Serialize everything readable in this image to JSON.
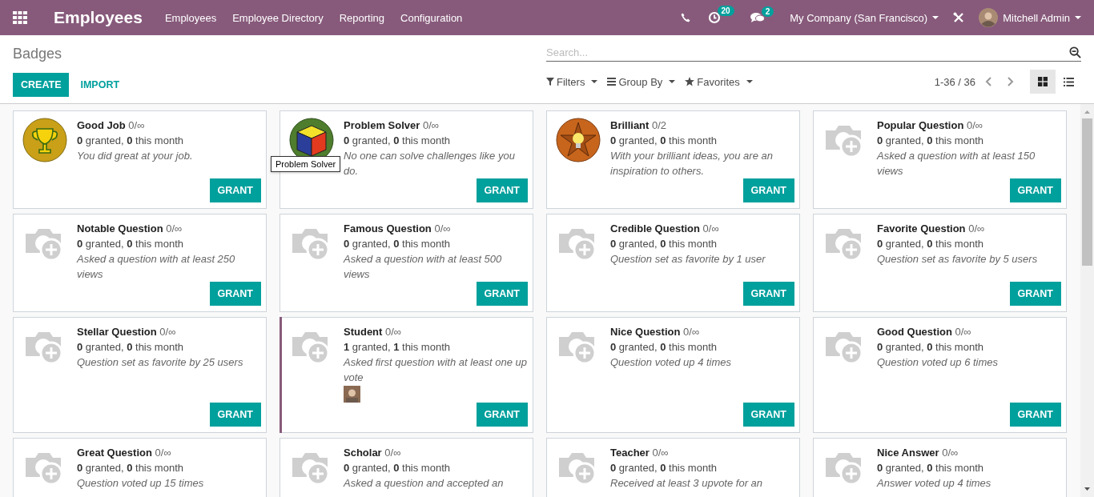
{
  "app": {
    "title": "Employees",
    "menu": [
      "Employees",
      "Employee Directory",
      "Reporting",
      "Configuration"
    ],
    "activity_count": "20",
    "message_count": "2",
    "company": "My Company (San Francisco)",
    "user": "Mitchell Admin"
  },
  "breadcrumb": "Badges",
  "buttons": {
    "create": "CREATE",
    "import": "IMPORT"
  },
  "search": {
    "placeholder": "Search..."
  },
  "search_options": [
    {
      "kind": "filter",
      "label": "Filters"
    },
    {
      "kind": "group",
      "label": "Group By"
    },
    {
      "kind": "star",
      "label": "Favorites"
    }
  ],
  "pager": "1-36 / 36",
  "views": [
    {
      "kind": "kanban",
      "selected": true
    },
    {
      "kind": "list",
      "selected": false
    }
  ],
  "badges": [
    {
      "name": "Good Job",
      "count": "0/∞",
      "granted": "**0** granted, **0** this month",
      "description": "You did great at your job.",
      "kind": "trophy",
      "highlighted": false,
      "holder_avatar": false,
      "button": "GRANT"
    },
    {
      "name": "Problem Solver",
      "count": "0/∞",
      "granted": "**0** granted, **0** this month",
      "description": "No one can solve challenges like you do.",
      "kind": "cube",
      "highlighted": false,
      "holder_avatar": false,
      "button": "GRANT",
      "tooltip": "Problem Solver"
    },
    {
      "name": "Brilliant",
      "count": "0/2",
      "granted": "**0** granted, **0** this month",
      "description": "With your brilliant ideas, you are an inspiration to others.",
      "kind": "bulb",
      "highlighted": false,
      "holder_avatar": false,
      "button": "GRANT"
    },
    {
      "name": "Popular Question",
      "count": "0/∞",
      "granted": "**0** granted, **0** this month",
      "description": "Asked a question with at least 150 views",
      "kind": "placeholder",
      "highlighted": false,
      "holder_avatar": false,
      "button": "GRANT"
    },
    {
      "name": "Notable Question",
      "count": "0/∞",
      "granted": "**0** granted, **0** this month",
      "description": "Asked a question with at least 250 views",
      "kind": "placeholder",
      "highlighted": false,
      "holder_avatar": false,
      "button": "GRANT"
    },
    {
      "name": "Famous Question",
      "count": "0/∞",
      "granted": "**0** granted, **0** this month",
      "description": "Asked a question with at least 500 views",
      "kind": "placeholder",
      "highlighted": false,
      "holder_avatar": false,
      "button": "GRANT"
    },
    {
      "name": "Credible Question",
      "count": "0/∞",
      "granted": "**0** granted, **0** this month",
      "description": "Question set as favorite by 1 user",
      "kind": "placeholder",
      "highlighted": false,
      "holder_avatar": false,
      "button": "GRANT"
    },
    {
      "name": "Favorite Question",
      "count": "0/∞",
      "granted": "**0** granted, **0** this month",
      "description": "Question set as favorite by 5 users",
      "kind": "placeholder",
      "highlighted": false,
      "holder_avatar": false,
      "button": "GRANT"
    },
    {
      "name": "Stellar Question",
      "count": "0/∞",
      "granted": "**0** granted, **0** this month",
      "description": "Question set as favorite by 25 users",
      "kind": "placeholder",
      "highlighted": false,
      "holder_avatar": false,
      "button": "GRANT"
    },
    {
      "name": "Student",
      "count": "0/∞",
      "granted": "**1** granted, **1** this month",
      "description": "Asked first question with at least one up vote",
      "kind": "placeholder",
      "highlighted": true,
      "holder_avatar": true,
      "button": "GRANT"
    },
    {
      "name": "Nice Question",
      "count": "0/∞",
      "granted": "**0** granted, **0** this month",
      "description": "Question voted up 4 times",
      "kind": "placeholder",
      "highlighted": false,
      "holder_avatar": false,
      "button": "GRANT"
    },
    {
      "name": "Good Question",
      "count": "0/∞",
      "granted": "**0** granted, **0** this month",
      "description": "Question voted up 6 times",
      "kind": "placeholder",
      "highlighted": false,
      "holder_avatar": false,
      "button": "GRANT"
    },
    {
      "name": "Great Question",
      "count": "0/∞",
      "granted": "**0** granted, **0** this month",
      "description": "Question voted up 15 times",
      "kind": "placeholder",
      "highlighted": false,
      "holder_avatar": false
    },
    {
      "name": "Scholar",
      "count": "0/∞",
      "granted": "**0** granted, **0** this month",
      "description": "Asked a question and accepted an",
      "kind": "placeholder",
      "highlighted": false,
      "holder_avatar": false
    },
    {
      "name": "Teacher",
      "count": "0/∞",
      "granted": "**0** granted, **0** this month",
      "description": "Received at least 3 upvote for an",
      "kind": "placeholder",
      "highlighted": false,
      "holder_avatar": false
    },
    {
      "name": "Nice Answer",
      "count": "0/∞",
      "granted": "**0** granted, **0** this month",
      "description": "Answer voted up 4 times",
      "kind": "placeholder",
      "highlighted": false,
      "holder_avatar": false
    }
  ]
}
